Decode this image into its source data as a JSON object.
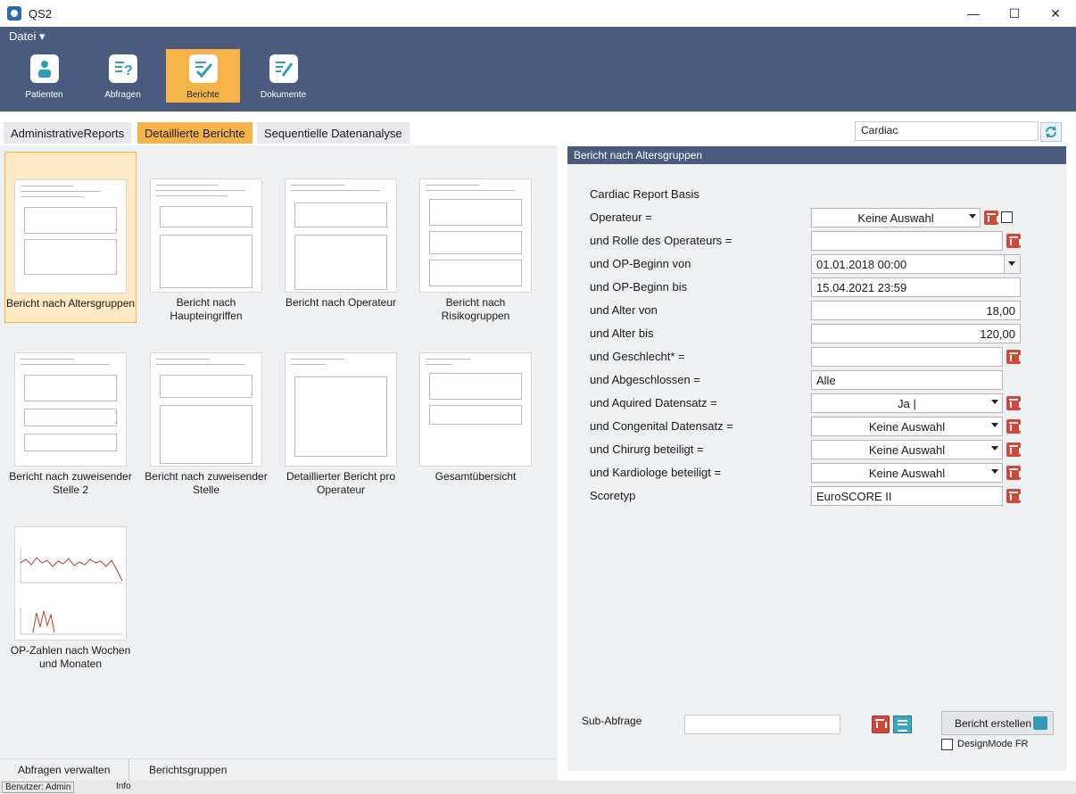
{
  "window": {
    "title": "QS2",
    "minimize": "—",
    "maximize": "☐",
    "close": "✕"
  },
  "menu": {
    "datei": "Datei ▾"
  },
  "ribbon": [
    {
      "label": "Patienten",
      "icon": "patient-icon",
      "active": false
    },
    {
      "label": "Abfragen",
      "icon": "question-icon",
      "active": false
    },
    {
      "label": "Berichte",
      "icon": "report-check-icon",
      "active": true
    },
    {
      "label": "Dokumente",
      "icon": "document-edit-icon",
      "active": false
    }
  ],
  "tabs": [
    {
      "label": "AdministrativeReports",
      "active": false
    },
    {
      "label": "Detaillierte Berichte",
      "active": true
    },
    {
      "label": "Sequentielle Datenanalyse",
      "active": false
    }
  ],
  "search": {
    "value": "Cardiac"
  },
  "reports": [
    {
      "label": "Bericht nach Altersgruppen",
      "selected": true
    },
    {
      "label": "Bericht nach Haupteingriffen",
      "selected": false
    },
    {
      "label": "Bericht nach Operateur",
      "selected": false
    },
    {
      "label": "Bericht nach Risikogruppen",
      "selected": false
    },
    {
      "label": "Bericht nach zuweisender Stelle 2",
      "selected": false
    },
    {
      "label": "Bericht nach zuweisender Stelle",
      "selected": false
    },
    {
      "label": "Detaillierter Bericht pro Operateur",
      "selected": false
    },
    {
      "label": "Gesamtübersicht",
      "selected": false
    },
    {
      "label": "OP-Zahlen nach Wochen und Monaten",
      "selected": false
    }
  ],
  "right": {
    "header": "Bericht nach Altersgruppen",
    "form_title": "Cardiac Report Basis",
    "rows": [
      {
        "label": "Operateur =",
        "value": "Keine Auswahl"
      },
      {
        "label": "und Rolle des Operateurs  =",
        "value": ""
      },
      {
        "label": "und OP-Beginn von",
        "value": "01.01.2018 00:00"
      },
      {
        "label": "und OP-Beginn bis",
        "value": "15.04.2021 23:59"
      },
      {
        "label": "und Alter von",
        "value": "18,00"
      },
      {
        "label": "und Alter bis",
        "value": "120,00"
      },
      {
        "label": "und Geschlecht* =",
        "value": ""
      },
      {
        "label": "und Abgeschlossen =",
        "value": "Alle"
      },
      {
        "label": "und Aquired Datensatz =",
        "value": "Ja |"
      },
      {
        "label": "und Congenital Datensatz =",
        "value": "Keine Auswahl"
      },
      {
        "label": "und Chirurg beteiligt =",
        "value": "Keine Auswahl"
      },
      {
        "label": "und Kardiologe beteiligt =",
        "value": "Keine Auswahl"
      },
      {
        "label": "Scoretyp",
        "value": "EuroSCORE II"
      }
    ],
    "sub_label": "Sub-Abfrage",
    "create_button": "Bericht erstellen",
    "design_mode": "DesignMode FR"
  },
  "bottom_tabs": {
    "manage": "Abfragen verwalten",
    "groups": "Berichtsgruppen"
  },
  "status": {
    "user": "Benutzer: Admin",
    "info": "Info"
  }
}
